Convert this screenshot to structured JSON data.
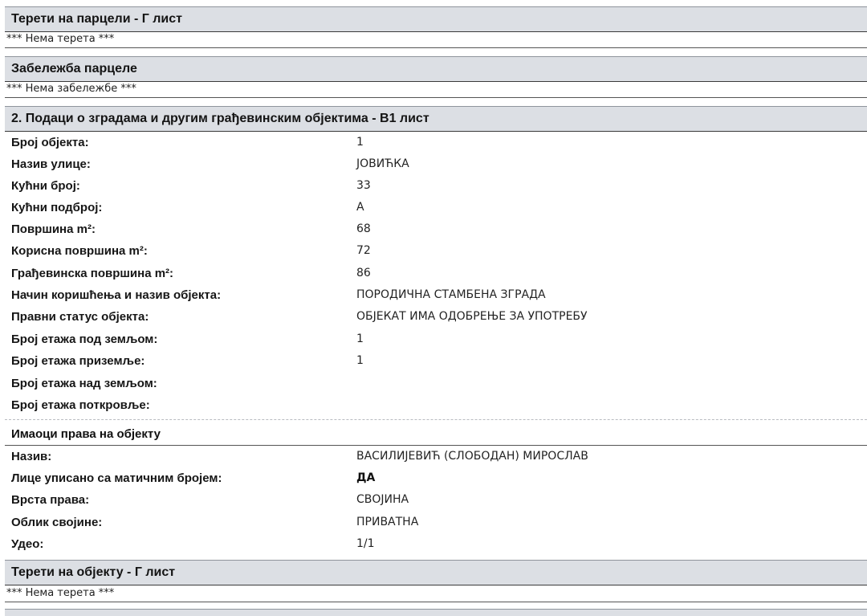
{
  "sections": {
    "parcel_burdens": {
      "title": "Терети на парцели - Г лист",
      "note": "*** Нема терета ***"
    },
    "parcel_notes": {
      "title": "Забележба парцеле",
      "note": "*** Нема забележбе ***"
    },
    "buildings": {
      "title": "2. Подаци о зградама и другим грађевинским објектима - В1 лист",
      "fields": [
        {
          "label": "Број објекта:",
          "value": "1"
        },
        {
          "label": "Назив улице:",
          "value": "ЈОВИЋКА"
        },
        {
          "label": "Кућни број:",
          "value": "33"
        },
        {
          "label": "Кућни подброј:",
          "value": "А"
        },
        {
          "label": "Површина m²:",
          "value": "68"
        },
        {
          "label": "Корисна површина m²:",
          "value": "72"
        },
        {
          "label": "Грађевинска површина m²:",
          "value": "86"
        },
        {
          "label": "Начин коришћења и назив објекта:",
          "value": "ПОРОДИЧНА СТАМБЕНА ЗГРАДА"
        },
        {
          "label": "Правни статус објекта:",
          "value": "ОБЈЕКАТ ИМА ОДОБРЕЊЕ ЗА УПОТРЕБУ"
        },
        {
          "label": "Број етажа под земљом:",
          "value": "1"
        },
        {
          "label": "Број етажа приземље:",
          "value": "1"
        },
        {
          "label": "Број етажа над земљом:",
          "value": ""
        },
        {
          "label": "Број етажа поткровље:",
          "value": ""
        }
      ]
    },
    "owners": {
      "title": "Имаоци права на објекту",
      "fields": [
        {
          "label": "Назив:",
          "value": "ВАСИЛИЈЕВИЋ (СЛОБОДАН) МИРОСЛАВ"
        },
        {
          "label": "Лице уписано са матичним бројем:",
          "value": "ДА"
        },
        {
          "label": "Врста права:",
          "value": "СВОЈИНА"
        },
        {
          "label": "Облик својине:",
          "value": "ПРИВАТНА"
        },
        {
          "label": "Удео:",
          "value": "1/1"
        }
      ]
    },
    "object_burdens": {
      "title": "Терети на објекту - Г лист",
      "note": "*** Нема терета ***"
    }
  }
}
